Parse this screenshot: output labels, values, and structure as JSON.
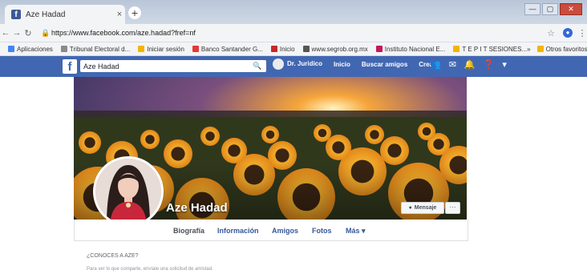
{
  "browser": {
    "tab_title": "Aze Hadad",
    "tab_close": "×",
    "new_tab": "+",
    "url": "https://www.facebook.com/aze.hadad?fref=nf",
    "window_controls": [
      "—",
      "▢",
      "✕"
    ],
    "bookmarks": [
      {
        "label": "Aplicaciones",
        "color": "#4285f4"
      },
      {
        "label": "Tribunal Electoral d...",
        "color": "#8a8a8a"
      },
      {
        "label": "Iniciar sesión",
        "color": "#f4b400"
      },
      {
        "label": "Banco Santander G...",
        "color": "#e53935"
      },
      {
        "label": "Inicio",
        "color": "#c62828"
      },
      {
        "label": "www.segrob.org.mx",
        "color": "#555555"
      },
      {
        "label": "Instituto Nacional E...",
        "color": "#c2185b"
      },
      {
        "label": "T E P I T SESIONES...",
        "color": "#f4b400"
      }
    ],
    "bookmarks_more": "»",
    "other_favorites": "Otros favoritos"
  },
  "facebook": {
    "logo": "f",
    "search_value": "Aze Hadad",
    "nav": [
      "Dr. Juridico",
      "Inicio",
      "Buscar amigos",
      "Crear"
    ],
    "brand_color": "#4267b2"
  },
  "profile": {
    "name": "Aze Hadad",
    "message_button": "Mensaje",
    "more_button": "···",
    "tabs": [
      "Biografía",
      "Información",
      "Amigos",
      "Fotos",
      "Más ▾"
    ],
    "know_label": "¿CONOCES A AZE?",
    "know_sub": "Para ver lo que comparte, envíale una solicitud de amistad."
  }
}
